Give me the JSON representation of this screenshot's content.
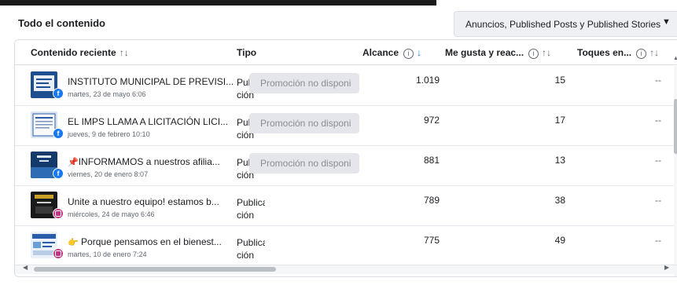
{
  "header": {
    "title": "Todo el contenido",
    "filter_label": "Anuncios, Published Posts y Published Stories"
  },
  "columns": {
    "content": "Contenido reciente",
    "content_sort": "↑↓",
    "type": "Tipo",
    "reach": "Alcance",
    "reach_sort": "↓",
    "likes": "Me gusta y reac...",
    "likes_sort": "↑↓",
    "taps": "Toques en...",
    "taps_sort": "↑↓",
    "info_glyph": "i"
  },
  "rows": [
    {
      "platform": "facebook",
      "title": "INSTITUTO MUNICIPAL DE PREVISI...",
      "date": "martes, 23 de mayo 6:06",
      "tipo": "Publica ción",
      "promo": "Promoción no disponi",
      "reach": "1.019",
      "likes": "15",
      "taps": "--"
    },
    {
      "platform": "facebook",
      "title": "EL IMPS LLAMA A LICITACIÓN LICI...",
      "date": "jueves, 9 de febrero 10:10",
      "tipo": "Publica ción",
      "promo": "Promoción no disponi",
      "reach": "972",
      "likes": "17",
      "taps": "--"
    },
    {
      "platform": "facebook",
      "title": "INFORMAMOS a nuestros afilia...",
      "date": "viernes, 20 de enero 8:07",
      "tipo": "Publica ción",
      "promo": "Promoción no disponi",
      "reach": "881",
      "likes": "13",
      "taps": "--"
    },
    {
      "platform": "instagram",
      "title": "Unite a nuestro equipo! estamos b...",
      "date": "miércoles, 24 de mayo 6:46",
      "tipo": "Publica ción",
      "promo": "",
      "reach": "789",
      "likes": "38",
      "taps": "--"
    },
    {
      "platform": "instagram",
      "title": "Porque pensamos en el bienest...",
      "date": "martes, 10 de enero 7:24",
      "tipo": "Publica ción",
      "promo": "",
      "reach": "775",
      "likes": "49",
      "taps": "--"
    }
  ],
  "colors": {
    "facebook": "#1877f2",
    "instagram": "#c13584",
    "accent_sort": "#1877f2"
  },
  "icons": {
    "filter_chevron": "chevron-down-icon",
    "pin": "pushpin-icon",
    "hand": "pointing-hand-icon"
  }
}
